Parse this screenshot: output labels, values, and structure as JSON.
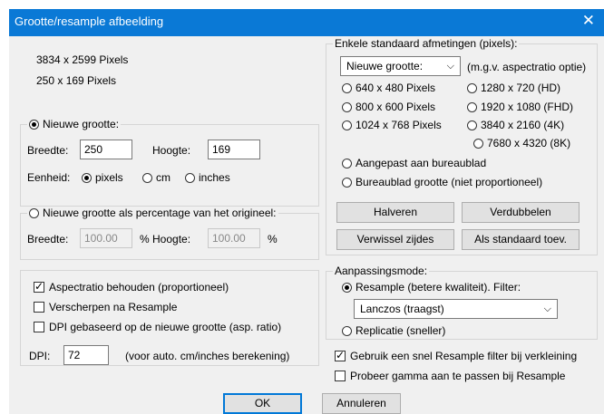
{
  "window": {
    "title": "Grootte/resample afbeelding",
    "close_glyph": "✕"
  },
  "info": {
    "original": "3834  x  2599  Pixels",
    "new": "250  x  169  Pixels"
  },
  "new_size": {
    "label": "Nieuwe grootte:",
    "width_label": "Breedte:",
    "width_value": "250",
    "height_label": "Hoogte:",
    "height_value": "169",
    "unit_label": "Eenheid:",
    "unit_pixels": "pixels",
    "unit_cm": "cm",
    "unit_inches": "inches"
  },
  "percentage": {
    "label": "Nieuwe grootte als percentage van het origineel:",
    "width_label": "Breedte:",
    "width_value": "100.00",
    "pct1": "%",
    "height_label": "Hoogte:",
    "height_value": "100.00",
    "pct2": "%"
  },
  "options": {
    "aspect": "Aspectratio behouden (proportioneel)",
    "sharpen": "Verscherpen na Resample",
    "dpi_based": "DPI gebaseerd op de nieuwe grootte (asp. ratio)",
    "dpi_label": "DPI:",
    "dpi_value": "72",
    "dpi_hint": "(voor auto. cm/inches berekening)"
  },
  "standard": {
    "title": "Enkele standaard afmetingen (pixels):",
    "dropdown": "Nieuwe grootte:",
    "dropdown_hint": "(m.g.v. aspectratio optie)",
    "r640": "640 x 480 Pixels",
    "r800": "800 x 600 Pixels",
    "r1024": "1024 x 768 Pixels",
    "r1280": "1280 x 720  (HD)",
    "r1920": "1920 x 1080 (FHD)",
    "r3840": "3840 x 2160 (4K)",
    "r7680": "7680 x 4320 (8K)",
    "desktop": "Aangepast aan bureaublad",
    "desktop_size": "Bureaublad grootte (niet proportioneel)",
    "halve": "Halveren",
    "double": "Verdubbelen",
    "swap": "Verwissel zijdes",
    "default": "Als standaard toev."
  },
  "mode": {
    "title": "Aanpassingsmode:",
    "resample": "Resample (betere kwaliteit). Filter:",
    "filter": "Lanczos (traagst)",
    "replicate": "Replicatie (sneller)"
  },
  "extra": {
    "fast": "Gebruik een snel Resample filter bij verkleining",
    "gamma": "Probeer gamma aan te passen bij Resample"
  },
  "footer": {
    "ok": "OK",
    "cancel": "Annuleren"
  }
}
